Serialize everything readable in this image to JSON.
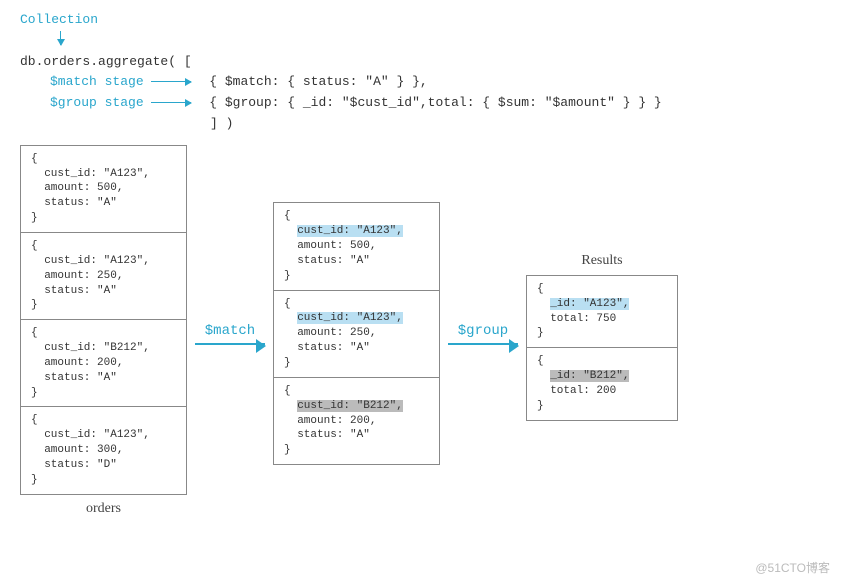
{
  "header": {
    "collection_label": "Collection",
    "code_line1": "db.orders.aggregate( [",
    "match_label": "$match stage",
    "group_label": "$group stage",
    "match_expr": "{ $match: { status: \"A\" } },",
    "group_expr": "{ $group: { _id: \"$cust_id\",total: { $sum: \"$amount\" } } }",
    "code_close": "] )"
  },
  "orders_title": "orders",
  "results_title": "Results",
  "stage1_label": "$match",
  "stage2_label": "$group",
  "orders": [
    {
      "cust_id": "A123",
      "amount": 500,
      "status": "A"
    },
    {
      "cust_id": "A123",
      "amount": 250,
      "status": "A"
    },
    {
      "cust_id": "B212",
      "amount": 200,
      "status": "A"
    },
    {
      "cust_id": "A123",
      "amount": 300,
      "status": "D"
    }
  ],
  "matched": [
    {
      "cust_id": "A123",
      "amount": 500,
      "status": "A",
      "hl": "blue"
    },
    {
      "cust_id": "A123",
      "amount": 250,
      "status": "A",
      "hl": "blue"
    },
    {
      "cust_id": "B212",
      "amount": 200,
      "status": "A",
      "hl": "grey"
    }
  ],
  "results": [
    {
      "_id": "A123",
      "total": 750,
      "hl": "blue"
    },
    {
      "_id": "B212",
      "total": 200,
      "hl": "grey"
    }
  ],
  "watermark": "@51CTO博客"
}
